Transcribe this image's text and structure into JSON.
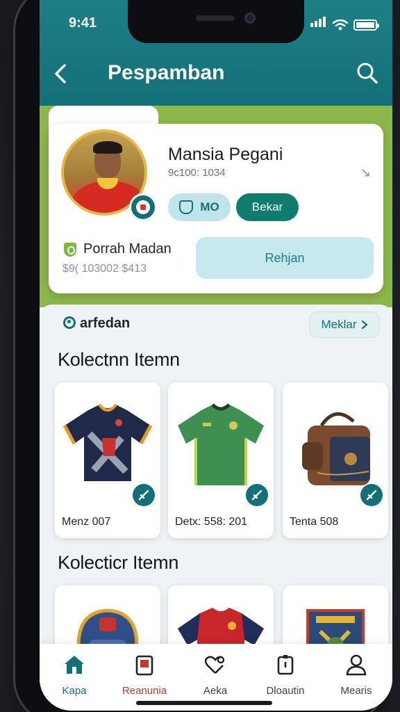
{
  "status_bar": {
    "time": "9:41"
  },
  "header": {
    "title": "Pespamban"
  },
  "profile": {
    "name": "Mansia Pegani",
    "id": "9c100: 1034",
    "chip_badge": "MO",
    "chip_action": "Bekar",
    "position_label": "Porrah Madan",
    "position_value": "$9( 103002 $413",
    "action_button": "Rehjan"
  },
  "section": {
    "label": "arfedan",
    "more_button": "Meklar"
  },
  "collection_1": {
    "title": "Kolectnn Itemn",
    "items": [
      {
        "caption": "Menz 007",
        "icon": "dark-jersey"
      },
      {
        "caption": "Detx: 558: 201",
        "icon": "green-jersey"
      },
      {
        "caption": "Tenta 508",
        "icon": "backpack"
      }
    ]
  },
  "collection_2": {
    "title": "Kolecticr Itemn",
    "items": [
      {
        "icon": "helmet-backpack"
      },
      {
        "icon": "red-jersey"
      },
      {
        "icon": "patch-badge"
      }
    ]
  },
  "tabbar": {
    "items": [
      {
        "label": "Kapa",
        "active": true
      },
      {
        "label": "Reanunia"
      },
      {
        "label": "Aeka"
      },
      {
        "label": "Dloautin"
      },
      {
        "label": "Mearis"
      }
    ]
  },
  "colors": {
    "primary": "#137077",
    "accent": "#8cb84b",
    "active_tab": "#137077",
    "alt_tab": "#c0392b"
  }
}
